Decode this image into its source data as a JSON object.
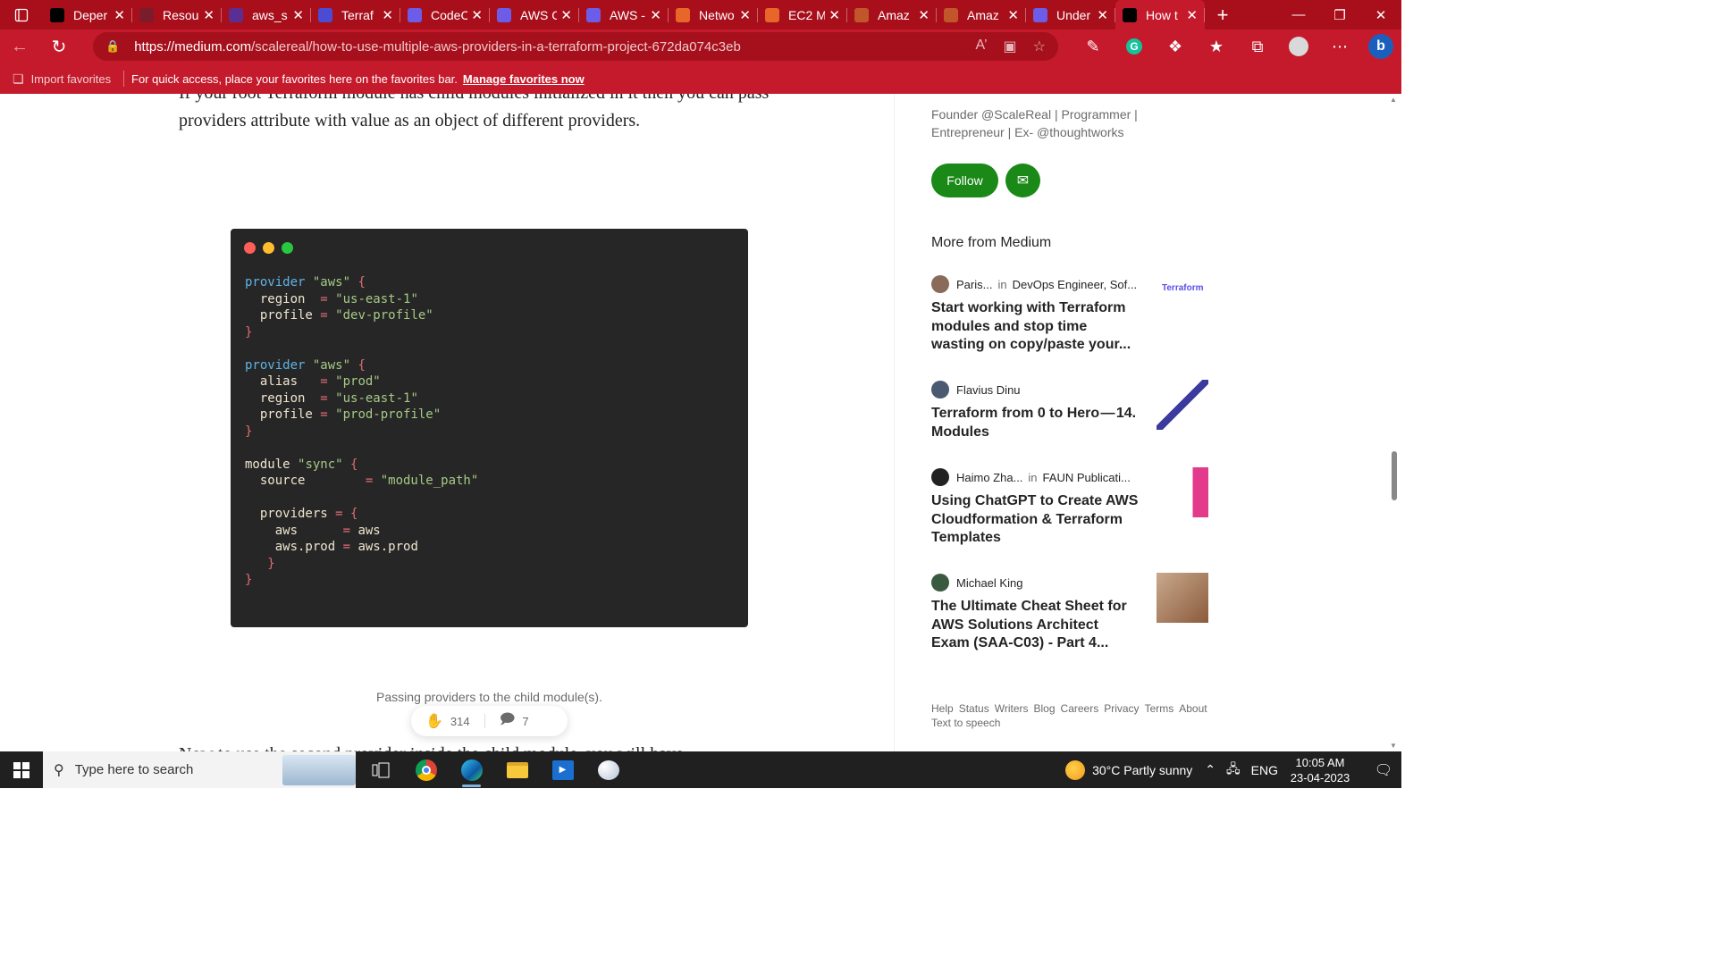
{
  "browser": {
    "tabs": [
      {
        "title": "Deper",
        "color": "#000000"
      },
      {
        "title": "Resou",
        "color": "#7b1c2c"
      },
      {
        "title": "aws_s",
        "color": "#5c2e91"
      },
      {
        "title": "Terraf",
        "color": "#4b4bd4"
      },
      {
        "title": "CodeC",
        "color": "#6c5ce7"
      },
      {
        "title": "AWS C",
        "color": "#6c5ce7"
      },
      {
        "title": "AWS -",
        "color": "#6c5ce7"
      },
      {
        "title": "Netwo",
        "color": "#e8662a"
      },
      {
        "title": "EC2 M",
        "color": "#e8662a"
      },
      {
        "title": "Amaz",
        "color": "#c0562a"
      },
      {
        "title": "Amaz",
        "color": "#c0562a"
      },
      {
        "title": "Under",
        "color": "#6c5ce7"
      },
      {
        "title": "How t",
        "color": "#000000",
        "active": true
      }
    ],
    "url_domain": "https://medium.com",
    "url_path": "/scalereal/how-to-use-multiple-aws-providers-in-a-terraform-project-672da074c3eb",
    "favbar": {
      "import": "Import favorites",
      "message": "For quick access, place your favorites here on the favorites bar.",
      "manage_link": "Manage favorites now"
    }
  },
  "article": {
    "para_top": "If your root Terraform module has child modules initialized in it then you can pass providers attribute with value as an object of different providers.",
    "code_lines": [
      [
        {
          "t": "provider ",
          "c": "kw"
        },
        {
          "t": "\"aws\"",
          "c": "str"
        },
        {
          "t": " {",
          "c": "br"
        }
      ],
      [
        {
          "t": "  region  ",
          "c": "id"
        },
        {
          "t": "= ",
          "c": "br"
        },
        {
          "t": "\"us-east-1\"",
          "c": "str"
        }
      ],
      [
        {
          "t": "  profile ",
          "c": "id"
        },
        {
          "t": "= ",
          "c": "br"
        },
        {
          "t": "\"dev-profile\"",
          "c": "str"
        }
      ],
      [
        {
          "t": "}",
          "c": "br"
        }
      ],
      [
        {
          "t": "",
          "c": "id"
        }
      ],
      [
        {
          "t": "provider ",
          "c": "kw"
        },
        {
          "t": "\"aws\"",
          "c": "str"
        },
        {
          "t": " {",
          "c": "br"
        }
      ],
      [
        {
          "t": "  alias   ",
          "c": "id"
        },
        {
          "t": "= ",
          "c": "br"
        },
        {
          "t": "\"prod\"",
          "c": "str"
        }
      ],
      [
        {
          "t": "  region  ",
          "c": "id"
        },
        {
          "t": "= ",
          "c": "br"
        },
        {
          "t": "\"us-east-1\"",
          "c": "str"
        }
      ],
      [
        {
          "t": "  profile ",
          "c": "id"
        },
        {
          "t": "= ",
          "c": "br"
        },
        {
          "t": "\"prod-profile\"",
          "c": "str"
        }
      ],
      [
        {
          "t": "}",
          "c": "br"
        }
      ],
      [
        {
          "t": "",
          "c": "id"
        }
      ],
      [
        {
          "t": "module ",
          "c": "id"
        },
        {
          "t": "\"sync\"",
          "c": "str"
        },
        {
          "t": " {",
          "c": "br"
        }
      ],
      [
        {
          "t": "  source        ",
          "c": "id"
        },
        {
          "t": "= ",
          "c": "br"
        },
        {
          "t": "\"module_path\"",
          "c": "str"
        }
      ],
      [
        {
          "t": "",
          "c": "id"
        }
      ],
      [
        {
          "t": "  providers ",
          "c": "id"
        },
        {
          "t": "= {",
          "c": "br"
        }
      ],
      [
        {
          "t": "    aws      ",
          "c": "id"
        },
        {
          "t": "= ",
          "c": "br"
        },
        {
          "t": "aws",
          "c": "id"
        }
      ],
      [
        {
          "t": "    aws.prod ",
          "c": "id"
        },
        {
          "t": "= ",
          "c": "br"
        },
        {
          "t": "aws.prod",
          "c": "id"
        }
      ],
      [
        {
          "t": "   }",
          "c": "br"
        }
      ],
      [
        {
          "t": "}",
          "c": "br"
        }
      ]
    ],
    "caption": "Passing providers to the child module(s).",
    "claps": "314",
    "responses": "7",
    "next_line": "Now to use the second provider inside the child module, you will have"
  },
  "sidebar": {
    "bio": "Founder @ScaleReal | Programmer | Entrepreneur | Ex- @thoughtworks",
    "follow_label": "Follow",
    "more_heading": "More from Medium",
    "cards": [
      {
        "author": "Paris...",
        "pub": "DevOps Engineer, Sof...",
        "title": "Start working with Terraform modules and stop time wasting on copy/paste your...",
        "avatar": "#8a6b5a",
        "thumb": "terraform",
        "thumb_text": "Terraform"
      },
      {
        "author": "Flavius Dinu",
        "pub": "",
        "title": "Terraform from 0 to Hero — 14. Modules",
        "avatar": "#4a5a70",
        "thumb": "stairs"
      },
      {
        "author": "Haimo Zha...",
        "pub": "FAUN Publicati...",
        "title": "Using ChatGPT to Create AWS Cloudformation & Terraform Templates",
        "avatar": "#222222",
        "thumb": "chatgpt"
      },
      {
        "author": "Michael King",
        "pub": "",
        "title": "The Ultimate Cheat Sheet for AWS Solutions Architect Exam (SAA-C03) - Part 4...",
        "avatar": "#3a5a40",
        "thumb": "person"
      }
    ],
    "in_word": "in",
    "footer_links": [
      "Help",
      "Status",
      "Writers",
      "Blog",
      "Careers",
      "Privacy",
      "Terms",
      "About",
      "Text to speech"
    ]
  },
  "taskbar": {
    "search_placeholder": "Type here to search",
    "weather": "30°C  Partly sunny",
    "lang": "ENG",
    "time": "10:05 AM",
    "date": "23-04-2023"
  }
}
